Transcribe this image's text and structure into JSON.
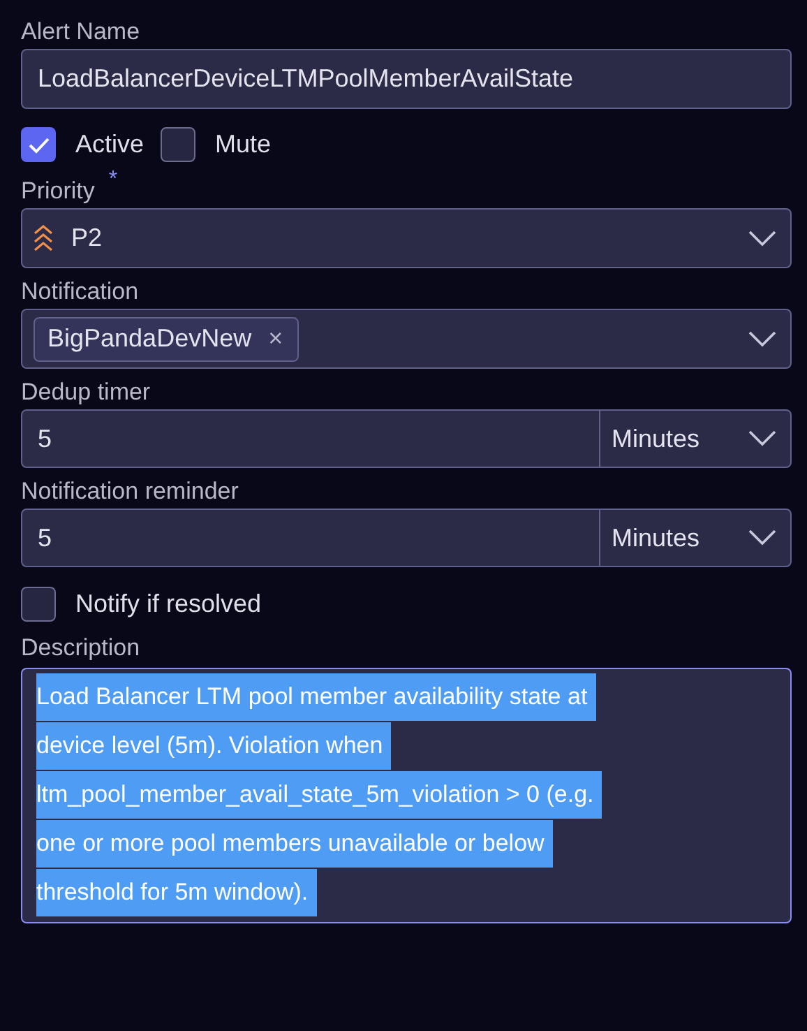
{
  "alert_name": {
    "label": "Alert Name",
    "value": "LoadBalancerDeviceLTMPoolMemberAvailState"
  },
  "toggles": [
    {
      "label": "Active",
      "checked": true
    },
    {
      "label": "Mute",
      "checked": false
    }
  ],
  "priority": {
    "label": "Priority",
    "required_mark": "*",
    "value": "P2"
  },
  "notification": {
    "label": "Notification",
    "tags": [
      {
        "label": "BigPandaDevNew",
        "remove": "×"
      }
    ]
  },
  "dedup_timer": {
    "label": "Dedup timer",
    "value": "5",
    "unit": "Minutes"
  },
  "notification_reminder": {
    "label": "Notification reminder",
    "value": "5",
    "unit": "Minutes"
  },
  "notify_if_resolved": {
    "label": "Notify if resolved",
    "checked": false
  },
  "description": {
    "label": "Description",
    "lines": [
      "Load Balancer LTM pool member availability state at",
      "device level (5m). Violation when",
      "ltm_pool_member_avail_state_5m_violation > 0 (e.g.",
      "one or more pool members unavailable or below",
      "threshold for 5m window)."
    ],
    "selected": true
  }
}
